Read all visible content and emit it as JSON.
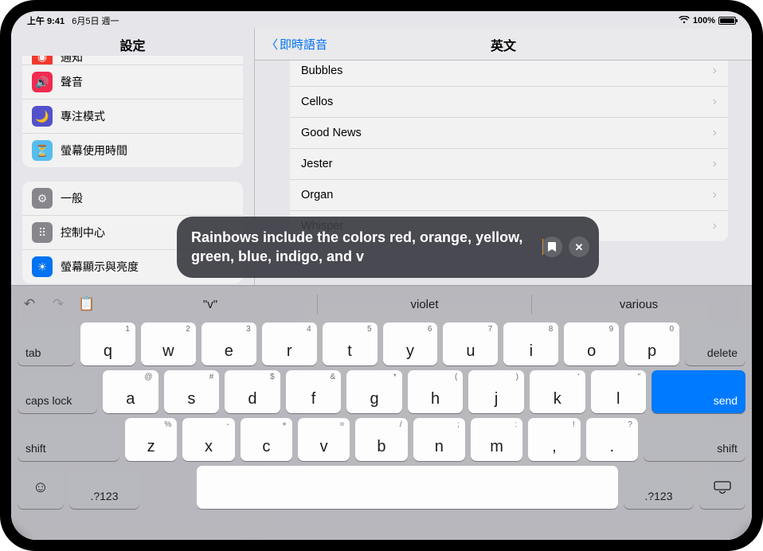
{
  "status": {
    "time": "上午 9:41",
    "date": "6月5日 週一",
    "battery_pct": "100%"
  },
  "sidebar": {
    "title": "設定",
    "group1": [
      {
        "label": "通知",
        "icon": "bell-icon",
        "color": "ic-red"
      },
      {
        "label": "聲音",
        "icon": "speaker-icon",
        "color": "ic-pink"
      },
      {
        "label": "專注模式",
        "icon": "moon-icon",
        "color": "ic-purple"
      },
      {
        "label": "螢幕使用時間",
        "icon": "hourglass-icon",
        "color": "ic-teal"
      }
    ],
    "group2": [
      {
        "label": "一般",
        "icon": "gear-icon",
        "color": "ic-gray"
      },
      {
        "label": "控制中心",
        "icon": "switches-icon",
        "color": "ic-gray"
      },
      {
        "label": "螢幕顯示與亮度",
        "icon": "brightness-icon",
        "color": "ic-blue"
      }
    ]
  },
  "main": {
    "back": "即時語音",
    "title": "英文",
    "items": [
      {
        "label": "Bubbles"
      },
      {
        "label": "Cellos"
      },
      {
        "label": "Good News"
      },
      {
        "label": "Jester"
      },
      {
        "label": "Organ"
      },
      {
        "label": "Whisper"
      }
    ]
  },
  "hud": {
    "text": "Rainbows include the colors red, orange, yellow, green, blue, indigo, and v"
  },
  "keyboard": {
    "suggestions": [
      "\"v\"",
      "violet",
      "various"
    ],
    "row1": [
      {
        "m": "q",
        "a": "1"
      },
      {
        "m": "w",
        "a": "2"
      },
      {
        "m": "e",
        "a": "3"
      },
      {
        "m": "r",
        "a": "4"
      },
      {
        "m": "t",
        "a": "5"
      },
      {
        "m": "y",
        "a": "6"
      },
      {
        "m": "u",
        "a": "7"
      },
      {
        "m": "i",
        "a": "8"
      },
      {
        "m": "o",
        "a": "9"
      },
      {
        "m": "p",
        "a": "0"
      }
    ],
    "row2": [
      {
        "m": "a",
        "a": "@"
      },
      {
        "m": "s",
        "a": "#"
      },
      {
        "m": "d",
        "a": "$"
      },
      {
        "m": "f",
        "a": "&"
      },
      {
        "m": "g",
        "a": "*"
      },
      {
        "m": "h",
        "a": "("
      },
      {
        "m": "j",
        "a": ")"
      },
      {
        "m": "k",
        "a": "'"
      },
      {
        "m": "l",
        "a": "\""
      }
    ],
    "row3": [
      {
        "m": "z",
        "a": "%"
      },
      {
        "m": "x",
        "a": "-"
      },
      {
        "m": "c",
        "a": "+"
      },
      {
        "m": "v",
        "a": "="
      },
      {
        "m": "b",
        "a": "/"
      },
      {
        "m": "n",
        "a": ";"
      },
      {
        "m": "m",
        "a": ":"
      },
      {
        "m": ",",
        "a": "!"
      },
      {
        "m": ".",
        "a": "?"
      }
    ],
    "labels": {
      "tab": "tab",
      "delete": "delete",
      "caps": "caps lock",
      "send": "send",
      "shift": "shift",
      "sym": ".?123"
    }
  }
}
